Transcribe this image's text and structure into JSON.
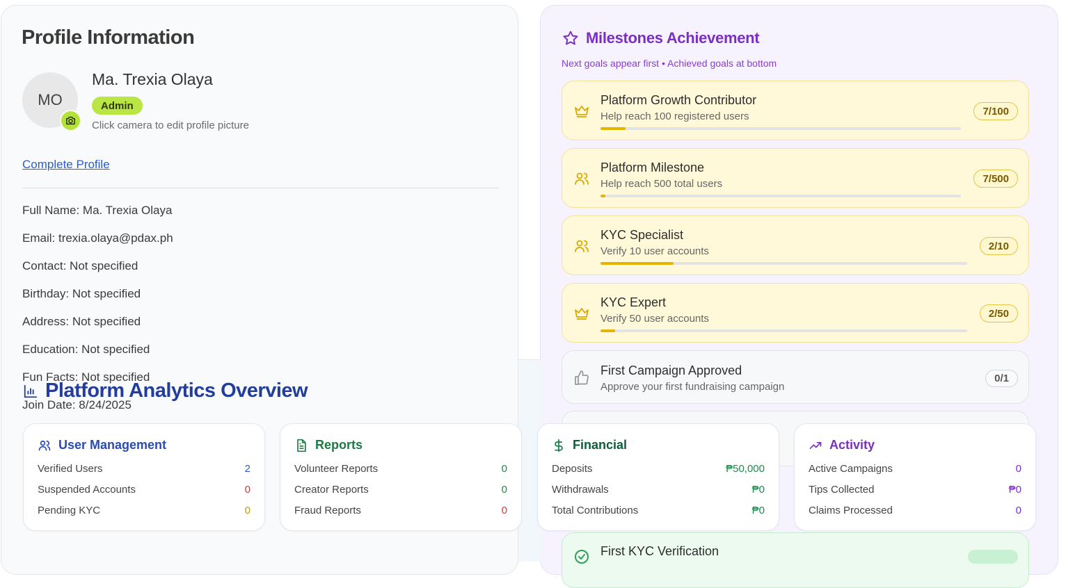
{
  "profile": {
    "title": "Profile Information",
    "initials": "MO",
    "name": "Ma. Trexia Olaya",
    "role": "Admin",
    "camera_hint": "Click camera to edit profile picture",
    "complete_link": "Complete Profile",
    "fields": [
      {
        "label": "Full Name:",
        "value": "Ma. Trexia Olaya"
      },
      {
        "label": "Email:",
        "value": "trexia.olaya@pdax.ph"
      },
      {
        "label": "Contact:",
        "value": "Not specified"
      },
      {
        "label": "Birthday:",
        "value": "Not specified"
      },
      {
        "label": "Address:",
        "value": "Not specified"
      },
      {
        "label": "Education:",
        "value": "Not specified"
      },
      {
        "label": "Fun Facts:",
        "value": "Not specified"
      },
      {
        "label": "Join Date:",
        "value": "8/24/2025"
      }
    ]
  },
  "milestones": {
    "title": "Milestones Achievement",
    "subtitle": "Next goals appear first • Achieved goals at bottom",
    "items": [
      {
        "name": "Platform Growth Contributor",
        "desc": "Help reach 100 registered users",
        "badge": "7/100",
        "progress": 0.07,
        "icon": "crown-icon"
      },
      {
        "name": "Platform Milestone",
        "desc": "Help reach 500 total users",
        "badge": "7/500",
        "progress": 0.014,
        "icon": "users-icon"
      },
      {
        "name": "KYC Specialist",
        "desc": "Verify 10 user accounts",
        "badge": "2/10",
        "progress": 0.2,
        "icon": "users-icon"
      },
      {
        "name": "KYC Expert",
        "desc": "Verify 50 user accounts",
        "badge": "2/50",
        "progress": 0.04,
        "icon": "crown-icon"
      },
      {
        "name": "First Campaign Approved",
        "desc": "Approve your first fundraising campaign",
        "badge": "0/1",
        "progress": 0,
        "icon": "thumbs-up-icon"
      },
      {
        "name": "First KYC Verification",
        "desc": "",
        "badge": "",
        "progress": 1,
        "icon": "check-icon"
      }
    ]
  },
  "analytics": {
    "title": "Platform Analytics Overview",
    "cards": [
      {
        "title": "User Management",
        "color": "#2a4bb3",
        "icon": "users-icon",
        "rows": [
          {
            "label": "Verified Users",
            "value": "2",
            "color": "#2a5dc4"
          },
          {
            "label": "Suspended Accounts",
            "value": "0",
            "color": "#d23a3a"
          },
          {
            "label": "Pending KYC",
            "value": "0",
            "color": "#c99a00"
          }
        ]
      },
      {
        "title": "Reports",
        "color": "#1d7a45",
        "icon": "document-icon",
        "rows": [
          {
            "label": "Volunteer Reports",
            "value": "0",
            "color": "#1e8a4c"
          },
          {
            "label": "Creator Reports",
            "value": "0",
            "color": "#1e8a4c"
          },
          {
            "label": "Fraud Reports",
            "value": "0",
            "color": "#d23a3a"
          }
        ]
      },
      {
        "title": "Financial",
        "color": "#0f5c3a",
        "icon": "dollar-icon",
        "rows": [
          {
            "label": "Deposits",
            "value": "₱50,000",
            "color": "#1e8a4c"
          },
          {
            "label": "Withdrawals",
            "value": "₱0",
            "color": "#1e8a4c"
          },
          {
            "label": "Total Contributions",
            "value": "₱0",
            "color": "#1e8a4c"
          }
        ]
      },
      {
        "title": "Activity",
        "color": "#7b2fc2",
        "icon": "trending-up-icon",
        "rows": [
          {
            "label": "Active Campaigns",
            "value": "0",
            "color": "#7b2fc2"
          },
          {
            "label": "Tips Collected",
            "value": "₱0",
            "color": "#7b2fc2"
          },
          {
            "label": "Claims Processed",
            "value": "0",
            "color": "#7b2fc2"
          }
        ]
      }
    ]
  }
}
